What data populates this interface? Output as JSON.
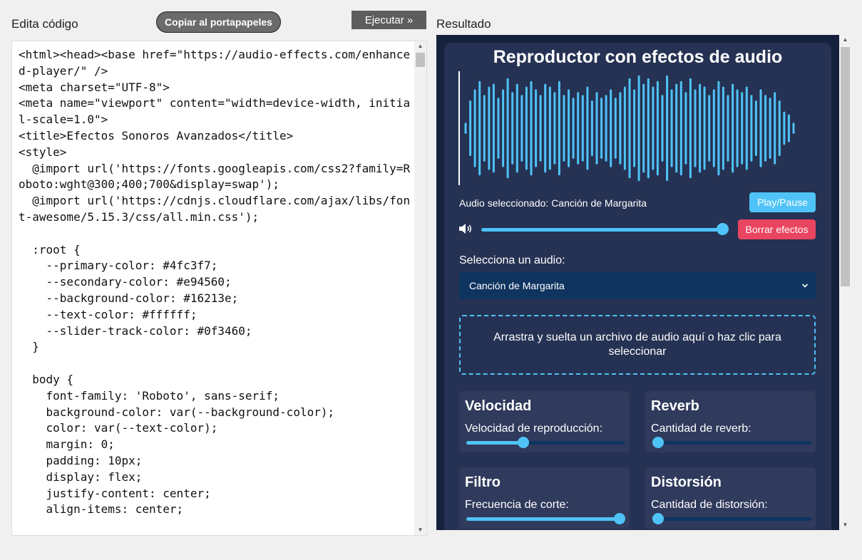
{
  "editor": {
    "label": "Edita código",
    "copy_label": "Copiar al portapapeles",
    "run_label": "Ejecutar »",
    "code": "<html><head><base href=\"https://audio-effects.com/enhanced-player/\" />\n<meta charset=\"UTF-8\">\n<meta name=\"viewport\" content=\"width=device-width, initial-scale=1.0\">\n<title>Efectos Sonoros Avanzados</title>\n<style>\n  @import url('https://fonts.googleapis.com/css2?family=Roboto:wght@300;400;700&display=swap');\n  @import url('https://cdnjs.cloudflare.com/ajax/libs/font-awesome/5.15.3/css/all.min.css');\n\n  :root {\n    --primary-color: #4fc3f7;\n    --secondary-color: #e94560;\n    --background-color: #16213e;\n    --text-color: #ffffff;\n    --slider-track-color: #0f3460;\n  }\n\n  body {\n    font-family: 'Roboto', sans-serif;\n    background-color: var(--background-color);\n    color: var(--text-color);\n    margin: 0;\n    padding: 10px;\n    display: flex;\n    justify-content: center;\n    align-items: center;"
  },
  "result": {
    "label": "Resultado",
    "title": "Reproductor con efectos de audio",
    "now_playing": "Audio seleccionado: Canción de Margarita",
    "play_label": "Play/Pause",
    "clear_label": "Borrar efectos",
    "volume": 1.0,
    "select_label": "Selecciona un audio:",
    "selected_audio": "Canción de Margarita",
    "dropzone_text": "Arrastra y suelta un archivo de audio aquí o haz clic para seleccionar",
    "effects": [
      {
        "title": "Velocidad",
        "label": "Velocidad de reproducción:",
        "value": 0.35
      },
      {
        "title": "Reverb",
        "label": "Cantidad de reverb:",
        "value": 0.0
      },
      {
        "title": "Filtro",
        "label": "Frecuencia de corte:",
        "value": 1.0
      },
      {
        "title": "Distorsión",
        "label": "Cantidad de distorsión:",
        "value": 0.0
      }
    ],
    "waveform_heights": [
      0.1,
      0.5,
      0.7,
      0.85,
      0.6,
      0.75,
      0.8,
      0.55,
      0.7,
      0.9,
      0.65,
      0.8,
      0.6,
      0.75,
      0.85,
      0.7,
      0.6,
      0.8,
      0.75,
      0.65,
      0.85,
      0.6,
      0.7,
      0.55,
      0.65,
      0.6,
      0.75,
      0.5,
      0.65,
      0.55,
      0.6,
      0.7,
      0.55,
      0.65,
      0.75,
      0.9,
      0.7,
      0.95,
      0.8,
      0.9,
      0.75,
      0.85,
      0.6,
      0.95,
      0.7,
      0.8,
      0.85,
      0.65,
      0.9,
      0.7,
      0.8,
      0.75,
      0.6,
      0.7,
      0.85,
      0.75,
      0.6,
      0.8,
      0.7,
      0.65,
      0.75,
      0.6,
      0.5,
      0.7,
      0.6,
      0.55,
      0.65,
      0.5,
      0.3,
      0.25,
      0.1
    ],
    "colors": {
      "primary": "#4fc3f7",
      "secondary": "#e94560",
      "background": "#16213e",
      "track": "#0f3460"
    }
  }
}
